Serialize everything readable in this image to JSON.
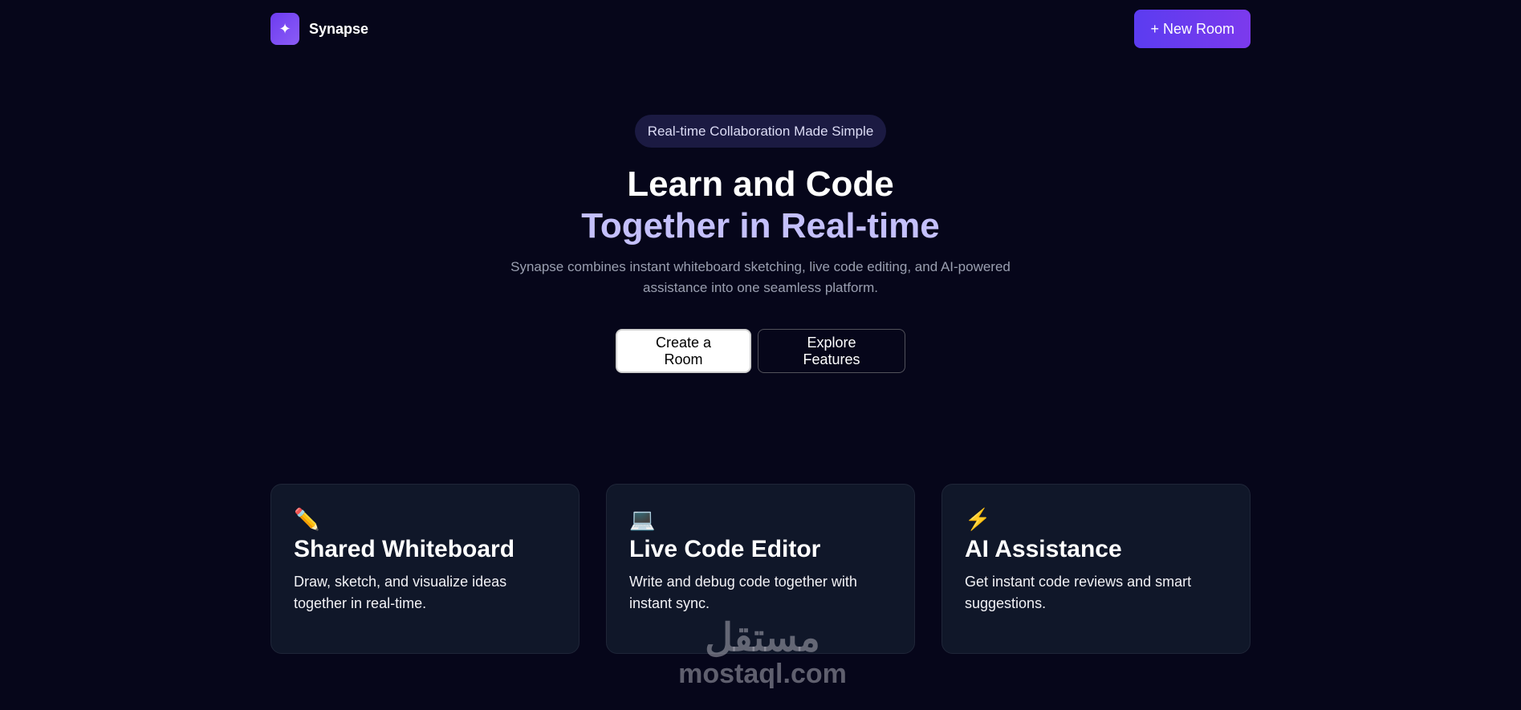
{
  "header": {
    "logo_icon": "sparkle-icon",
    "logo_glyph": "✦",
    "brand": "Synapse",
    "new_room_label": "+ New Room"
  },
  "hero": {
    "badge": "Real-time Collaboration Made Simple",
    "title_line1": "Learn and Code",
    "title_line2": "Together in Real-time",
    "subtitle": "Synapse combines instant whiteboard sketching, live code editing, and AI-powered assistance into one seamless platform.",
    "primary_cta": "Create a Room",
    "secondary_cta": "Explore Features"
  },
  "features": [
    {
      "icon": "pencil-icon",
      "glyph": "✏️",
      "title": "Shared Whiteboard",
      "description": "Draw, sketch, and visualize ideas together in real-time."
    },
    {
      "icon": "laptop-icon",
      "glyph": "💻",
      "title": "Live Code Editor",
      "description": "Write and debug code together with instant sync."
    },
    {
      "icon": "lightning-icon",
      "glyph": "⚡",
      "title": "AI Assistance",
      "description": "Get instant code reviews and smart suggestions."
    }
  ],
  "watermark": {
    "arabic": "مستقل",
    "domain": "mostaql.com"
  },
  "colors": {
    "background": "#06061a",
    "accent": "#6d3cf0",
    "title_highlight": "#c4c0fb",
    "card_bg": "#101729"
  }
}
